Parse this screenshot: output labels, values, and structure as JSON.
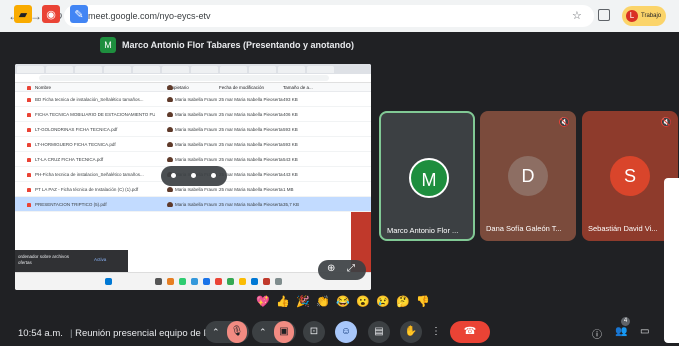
{
  "browser": {
    "url": "meet.google.com/nyo-eycs-etv",
    "profile_label": "Trabajo",
    "profile_initial": "L"
  },
  "meet": {
    "presenter_initial": "M",
    "presenter_title": "Marco Antonio Flor Tabares (Presentando y anotando)",
    "time": "10:54 a.m.",
    "separator": "|",
    "meeting_title": "Reunión presencial equipo de Pl..."
  },
  "shared_screen": {
    "columns": [
      "Nombre",
      "Propietario",
      "Fecha de modificación",
      "Tamaño de a..."
    ],
    "files": [
      {
        "name": "BD Ficha tecnica de instalación_Señalético tamaños...",
        "owner": "Maria Isabella Fraum San...",
        "date": "25 mar Maria Isabella Pieosertas",
        "size": "493 KB",
        "selected": false
      },
      {
        "name": "FICHA TECNICA MOBILIARIO DE ESTACIONAMIENTO FU...",
        "owner": "Maria Isabella Fraum San...",
        "date": "25 mar Maria Isabella Pieosertas",
        "size": "406 KB",
        "selected": false
      },
      {
        "name": "LT-GOLONDRINAS FICHA TECNICA.pdf",
        "owner": "Maria Isabella Fraum San...",
        "date": "25 mar Maria Isabella Pieosertas",
        "size": "593 KB",
        "selected": false
      },
      {
        "name": "LT-HORMIGUERO FICHA TECNICA.pdf",
        "owner": "Maria Isabella Fraum San...",
        "date": "25 mar Maria Isabella Pieosertas",
        "size": "593 KB",
        "selected": false
      },
      {
        "name": "LT-LA CRUZ FICHA TECNICA.pdf",
        "owner": "Maria Isabella Fraum San...",
        "date": "25 mar Maria Isabella Pieosertas",
        "size": "543 KB",
        "selected": false
      },
      {
        "name": "PH-Ficha tecnica de instalacion_Señalético tamaños...",
        "owner": "Maria Isabella Fraum San...",
        "date": "25 mar Maria Isabella Pieosertas",
        "size": "443 KB",
        "selected": false
      },
      {
        "name": "PT LA PAZ - Ficha técnica de Instalación (C) (1).pdf",
        "owner": "Maria Isabella Fraum San...",
        "date": "25 mar Maria Isabella Pieosertas",
        "size": "1 MB",
        "selected": false
      },
      {
        "name": "PRESENTACION TRIPTICO (5).pdf",
        "owner": "Maria Isabella Fraum San...",
        "date": "25 mar Maria Isabella Pieosertas",
        "size": "35,7 KB",
        "selected": true
      }
    ],
    "toast_text": "ordenador sobre archivos ofertas",
    "toast_action": "Activa"
  },
  "participants": [
    {
      "initial": "M",
      "name": "Marco Antonio Flor ...",
      "color": "#1e8e3e",
      "tile_bg": "#3c4043",
      "muted": false,
      "active": true
    },
    {
      "initial": "D",
      "name": "Dana Sofía Galeón T...",
      "color": "#8d6e63",
      "tile_bg": "#7b4b3c",
      "muted": true,
      "active": false
    },
    {
      "initial": "S",
      "name": "Sebastián David Vi...",
      "color": "#d9452b",
      "tile_bg": "#8e3b2c",
      "muted": true,
      "active": false
    }
  ],
  "reactions": [
    "💖",
    "👍",
    "🎉",
    "👏",
    "😂",
    "😮",
    "😢",
    "🤔",
    "👎"
  ],
  "people_count": "4",
  "colors": {
    "meet_bg": "#202124",
    "control_bg": "#3c4043",
    "leave_red": "#ea4335",
    "mic_off_pink": "#f28b82",
    "emoji_active_blue": "#a8c7fa"
  }
}
